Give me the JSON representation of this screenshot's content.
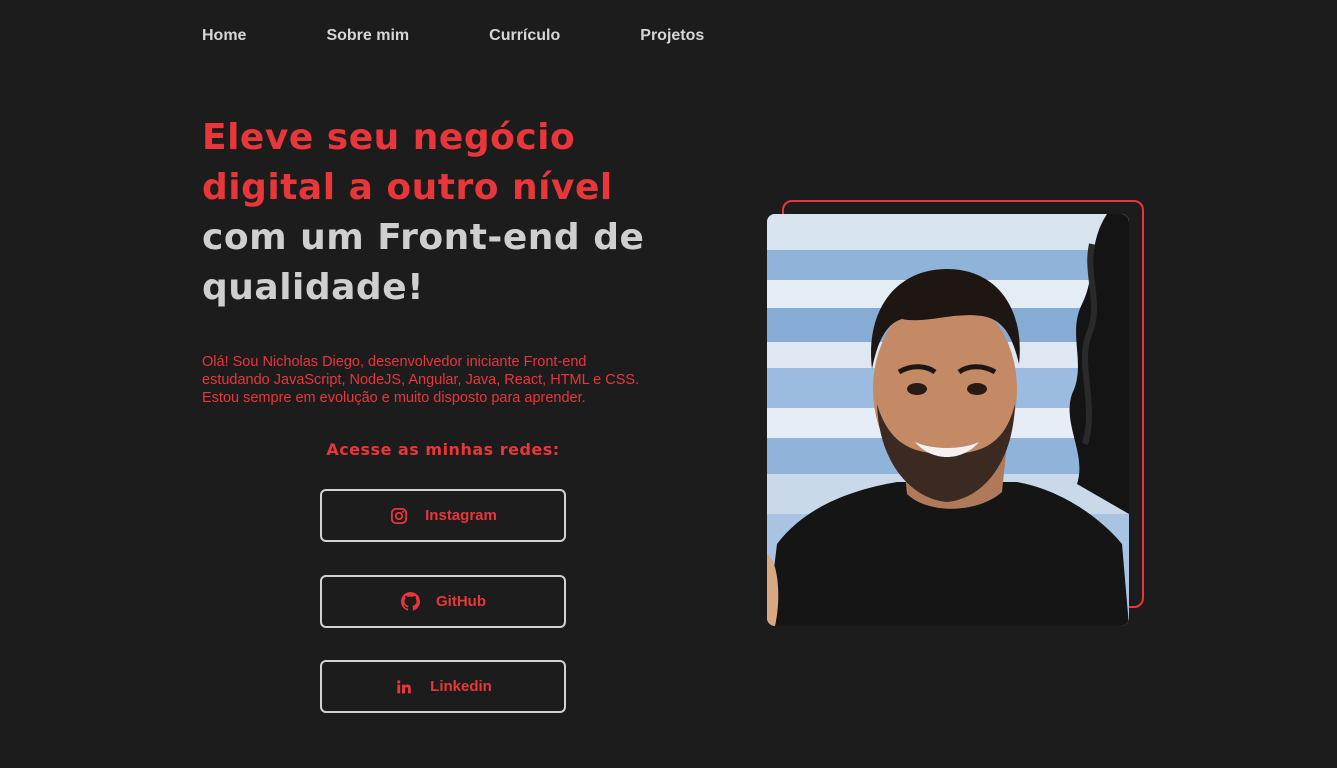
{
  "nav": {
    "items": [
      {
        "label": "Home"
      },
      {
        "label": "Sobre mim"
      },
      {
        "label": "Currículo"
      },
      {
        "label": "Projetos"
      }
    ]
  },
  "hero": {
    "headline_red_1": "Eleve seu negócio",
    "headline_red_2": "digital a outro nível",
    "headline_grey_1": "com um Front-end de",
    "headline_grey_2": "qualidade!",
    "intro_line_1": "Olá! Sou Nicholas Diego, desenvolvedor iniciante Front-end",
    "intro_line_2": "estudando JavaScript, NodeJS, Angular, Java, React, HTML e CSS.",
    "intro_line_3": "Estou sempre em evolução e muito disposto para aprender."
  },
  "networks": {
    "title": "Acesse as minhas redes:",
    "buttons": [
      {
        "label": "Instagram",
        "icon": "instagram-icon"
      },
      {
        "label": "GitHub",
        "icon": "github-icon"
      },
      {
        "label": "Linkedin",
        "icon": "linkedin-icon"
      }
    ]
  },
  "colors": {
    "accent": "#e8363a",
    "background": "#1c1c1d",
    "text_light": "#d6d6d6"
  }
}
